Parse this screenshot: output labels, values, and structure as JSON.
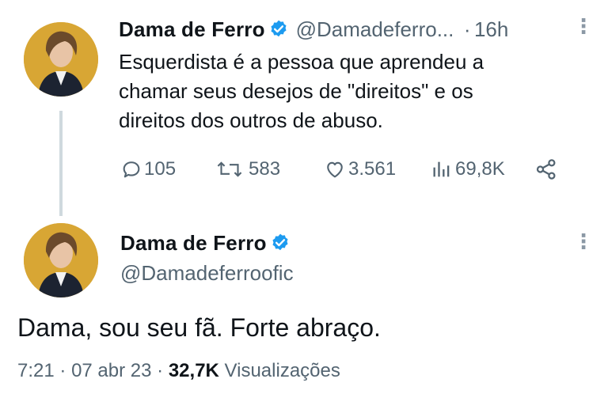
{
  "tweet1": {
    "name": "Dama de Ferro",
    "handle": "@Damadeferro...",
    "separator": "·",
    "time": "16h",
    "text_lines": [
      "Esquerdista é a pessoa que aprendeu a",
      "chamar seus desejos de \"direitos\" e os",
      "direitos dos outros de abuso."
    ],
    "replies": "105",
    "retweets": "583",
    "likes": "3.561",
    "views": "69,8K"
  },
  "tweet2": {
    "name": "Dama de Ferro",
    "handle": "@Damadeferroofic",
    "text": "Dama, sou seu fã. Forte abraço.",
    "time": "7:21",
    "sep1": "·",
    "date": "07 abr 23",
    "sep2": "·",
    "views_count": "32,7K",
    "views_label": "Visualizações"
  },
  "colors": {
    "verified": "#1d9bf0",
    "text": "#0f1419",
    "secondary": "#536471",
    "avatar_bg": "#d8a634"
  },
  "icons": [
    "verified-icon",
    "more-icon",
    "reply-icon",
    "retweet-icon",
    "like-icon",
    "views-icon",
    "share-icon"
  ]
}
